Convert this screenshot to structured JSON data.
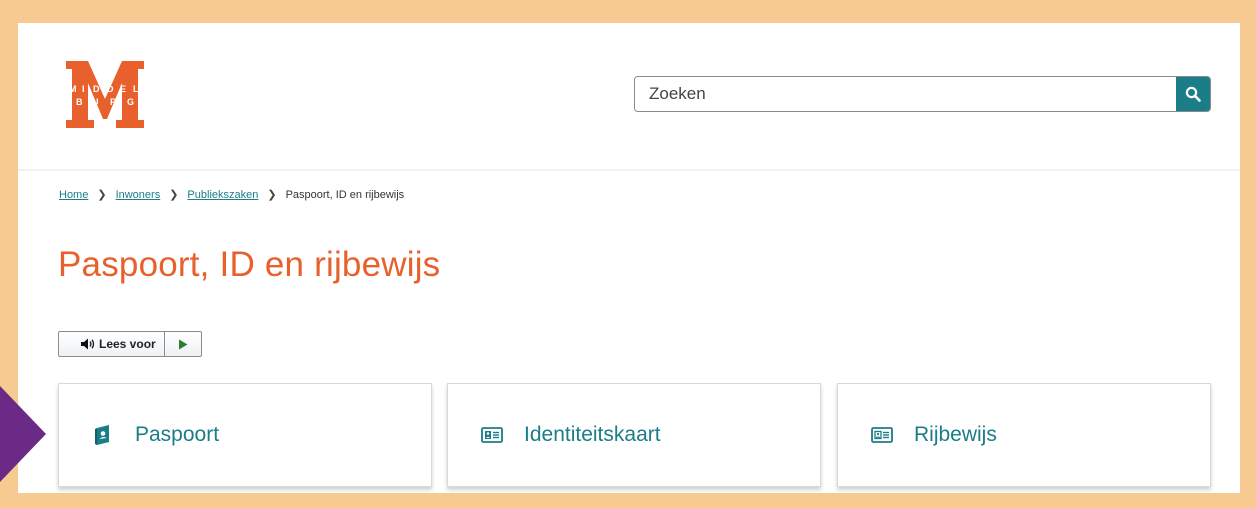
{
  "header": {
    "logo": {
      "name": "MIDDELBURG",
      "letters_top": [
        "M",
        "I",
        "D",
        "D",
        "E",
        "L"
      ],
      "letters_bottom": [
        "B",
        "U",
        "R",
        "G"
      ],
      "color": "#e8602c"
    },
    "search": {
      "placeholder": "Zoeken",
      "value": "",
      "button_color": "#1a7d87"
    }
  },
  "breadcrumb": {
    "items": [
      {
        "label": "Home",
        "link": true
      },
      {
        "label": "Inwoners",
        "link": true
      },
      {
        "label": "Publiekszaken",
        "link": true
      },
      {
        "label": "Paspoort, ID en rijbewijs",
        "link": false
      }
    ]
  },
  "page": {
    "title": "Paspoort, ID en rijbewijs",
    "title_color": "#e8602c"
  },
  "readspeaker": {
    "label": "Lees voor"
  },
  "cards": [
    {
      "label": "Paspoort",
      "icon": "passport-icon"
    },
    {
      "label": "Identiteitskaart",
      "icon": "id-card-icon"
    },
    {
      "label": "Rijbewijs",
      "icon": "drivers-license-icon"
    }
  ],
  "colors": {
    "accent": "#1a7d87",
    "brand": "#e8602c",
    "frame": "#f7ca92",
    "arrow": "#6a2a86"
  }
}
